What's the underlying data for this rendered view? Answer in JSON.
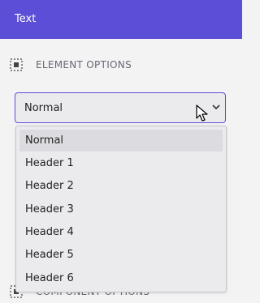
{
  "header": {
    "title": "Text"
  },
  "element_options": {
    "title": "ELEMENT OPTIONS",
    "icon": "select-frame-icon"
  },
  "component_options": {
    "title": "COMPONENT OPTIONS",
    "icon": "select-frame-icon"
  },
  "heading_select": {
    "value": "Normal",
    "options": [
      "Normal",
      "Header 1",
      "Header 2",
      "Header 3",
      "Header 4",
      "Header 5",
      "Header 6"
    ],
    "selected_index": 0
  },
  "colors": {
    "accent": "#5a4fd6",
    "panel": "#f3f3f4",
    "field": "#ebeaed"
  }
}
